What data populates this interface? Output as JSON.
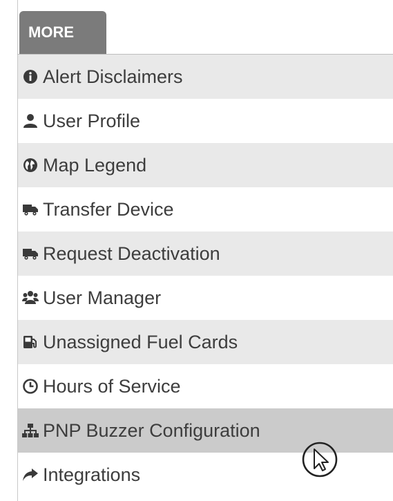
{
  "tab": {
    "label": "MORE"
  },
  "menu": {
    "items": [
      {
        "label": "Alert Disclaimers",
        "icon": "info-circle-icon"
      },
      {
        "label": "User Profile",
        "icon": "user-icon"
      },
      {
        "label": "Map Legend",
        "icon": "globe-icon"
      },
      {
        "label": "Transfer Device",
        "icon": "truck-icon"
      },
      {
        "label": "Request Deactivation",
        "icon": "truck-icon"
      },
      {
        "label": "User Manager",
        "icon": "users-icon"
      },
      {
        "label": "Unassigned Fuel Cards",
        "icon": "fuel-pump-icon"
      },
      {
        "label": "Hours of Service",
        "icon": "clock-icon"
      },
      {
        "label": "PNP Buzzer Configuration",
        "icon": "sitemap-icon"
      },
      {
        "label": "Integrations",
        "icon": "share-arrow-icon"
      }
    ],
    "hovered_item": "PNP Buzzer Configuration"
  },
  "colors": {
    "tab_background": "#7b7b7b",
    "row_striped": "#e9e9e9",
    "row_hover": "#cbcbcb",
    "text": "#3d3d3d"
  }
}
